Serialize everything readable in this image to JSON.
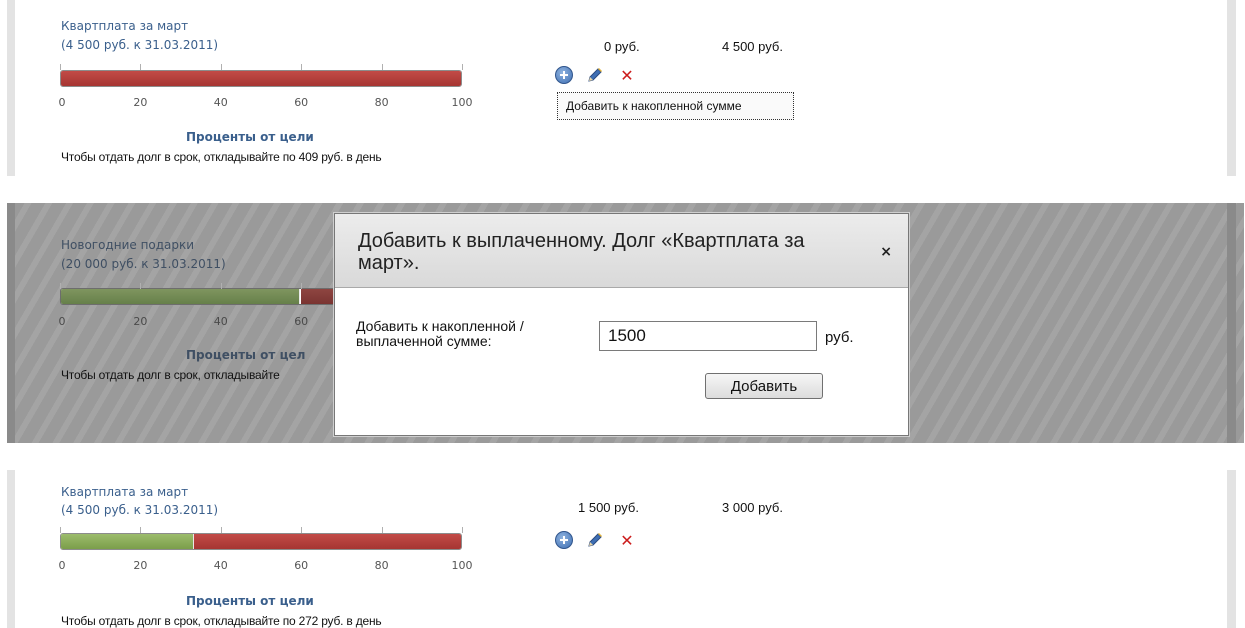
{
  "debts_before": {
    "title": "Квартплата за март",
    "subtitle": "(4 500 руб. к 31.03.2011)",
    "paid": "0 руб.",
    "remaining": "4 500 руб.",
    "progress_paid_percent": 0,
    "axis_ticks": [
      "0",
      "20",
      "40",
      "60",
      "80",
      "100"
    ],
    "axis_title": "Проценты от цели",
    "hint": "Чтобы отдать долг в срок, откладывайте по 409 руб. в день",
    "tooltip": "Добавить к накопленной сумме"
  },
  "background_debt": {
    "title": "Новогодние подарки",
    "subtitle": "(20 000 руб. к 31.03.2011)",
    "progress_paid_percent": 60,
    "axis_ticks": [
      "0",
      "20",
      "40",
      "60"
    ],
    "axis_title": "Проценты от цел",
    "hint": "Чтобы отдать долг в срок, откладывайте"
  },
  "modal": {
    "title": "Добавить к выплаченному. Долг «Квартплата за март».",
    "close_glyph": "×",
    "field_label": "Добавить к накопленной / выплаченной сумме:",
    "amount_value": "1500",
    "unit": "руб.",
    "submit_label": "Добавить"
  },
  "debts_after": {
    "title": "Квартплата за март",
    "subtitle": "(4 500 руб. к 31.03.2011)",
    "paid": "1 500 руб.",
    "remaining": "3 000 руб.",
    "progress_paid_percent": 33.3,
    "axis_ticks": [
      "0",
      "20",
      "40",
      "60",
      "80",
      "100"
    ],
    "axis_title": "Проценты от цели",
    "hint": "Чтобы отдать долг в срок, откладывайте по 272 руб. в день"
  },
  "icons": {
    "add": "plus-circle-icon",
    "edit": "pencil-icon",
    "delete": "red-x-icon",
    "delete_glyph": "✕"
  },
  "colors": {
    "progress_remaining": "#b03c39",
    "progress_paid": "#8aad5a",
    "title_link": "#3a5f8c"
  }
}
